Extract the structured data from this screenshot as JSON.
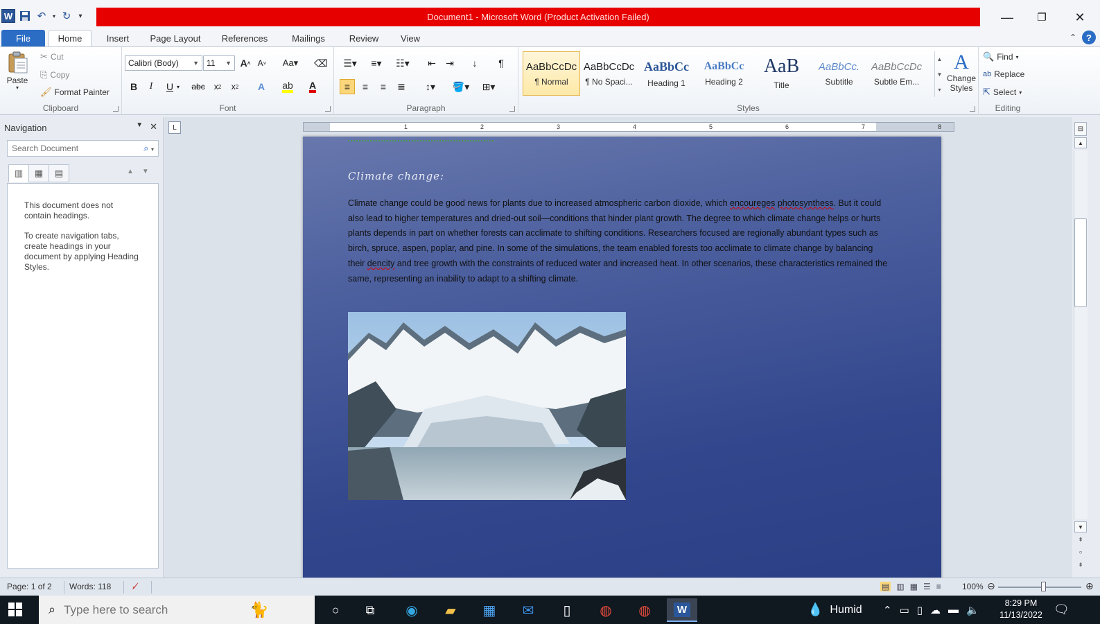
{
  "window": {
    "title": "Document1 - Microsoft Word (Product Activation Failed)",
    "minimize": "—",
    "restore": "❐",
    "close": "✕"
  },
  "tabs": [
    "File",
    "Home",
    "Insert",
    "Page Layout",
    "References",
    "Mailings",
    "Review",
    "View"
  ],
  "ribbon": {
    "clipboard": {
      "label": "Clipboard",
      "paste": "Paste",
      "cut": "Cut",
      "copy": "Copy",
      "format_painter": "Format Painter"
    },
    "font": {
      "label": "Font",
      "font_name": "Calibri (Body)",
      "font_size": "11"
    },
    "paragraph": {
      "label": "Paragraph"
    },
    "styles": {
      "label": "Styles",
      "items": [
        {
          "sample": "AaBbCcDc",
          "name": "¶ Normal"
        },
        {
          "sample": "AaBbCcDc",
          "name": "¶ No Spaci..."
        },
        {
          "sample": "AaBbCc",
          "name": "Heading 1"
        },
        {
          "sample": "AaBbCc",
          "name": "Heading 2"
        },
        {
          "sample": "AaB",
          "name": "Title"
        },
        {
          "sample": "AaBbCc.",
          "name": "Subtitle"
        },
        {
          "sample": "AaBbCcDc",
          "name": "Subtle Em..."
        }
      ],
      "change_styles": "Change Styles"
    },
    "editing": {
      "label": "Editing",
      "find": "Find",
      "replace": "Replace",
      "select": "Select"
    }
  },
  "navigation": {
    "title": "Navigation",
    "search_placeholder": "Search Document",
    "msg1": "This document does not contain headings.",
    "msg2": "To create navigation tabs, create headings in your document by applying Heading Styles."
  },
  "ruler": {
    "numbers": [
      "1",
      "2",
      "3",
      "4",
      "5",
      "6",
      "7",
      "8"
    ]
  },
  "document": {
    "heading": "Climate change:",
    "body_part1": "Climate change could be good news for plants due to increased atmospheric carbon dioxide, which ",
    "body_word1": "encoureges",
    "body_word2": "photosynthess",
    "body_part2": ". But it could also lead to higher temperatures and dried-out soil—conditions that hinder plant growth. The degree to which climate change helps or hurts plants depends in part on whether forests can acclimate to shifting conditions. Researchers focused are regionally abundant types such as birch, spruce, aspen, poplar, and pine. In some of the simulations, the team enabled forests too acclimate to climate change by balancing their ",
    "body_word3": "dencity",
    "body_part3": " and tree growth with the constraints of reduced water and increased heat. In other scenarios, these characteristics remained the same, representing an inability to adapt to a shifting climate."
  },
  "status": {
    "page": "Page: 1 of 2",
    "words": "Words: 118",
    "zoom": "100%"
  },
  "taskbar": {
    "search_placeholder": "Type here to search",
    "weather": "Humid",
    "time": "8:29 PM",
    "date": "11/13/2022"
  }
}
